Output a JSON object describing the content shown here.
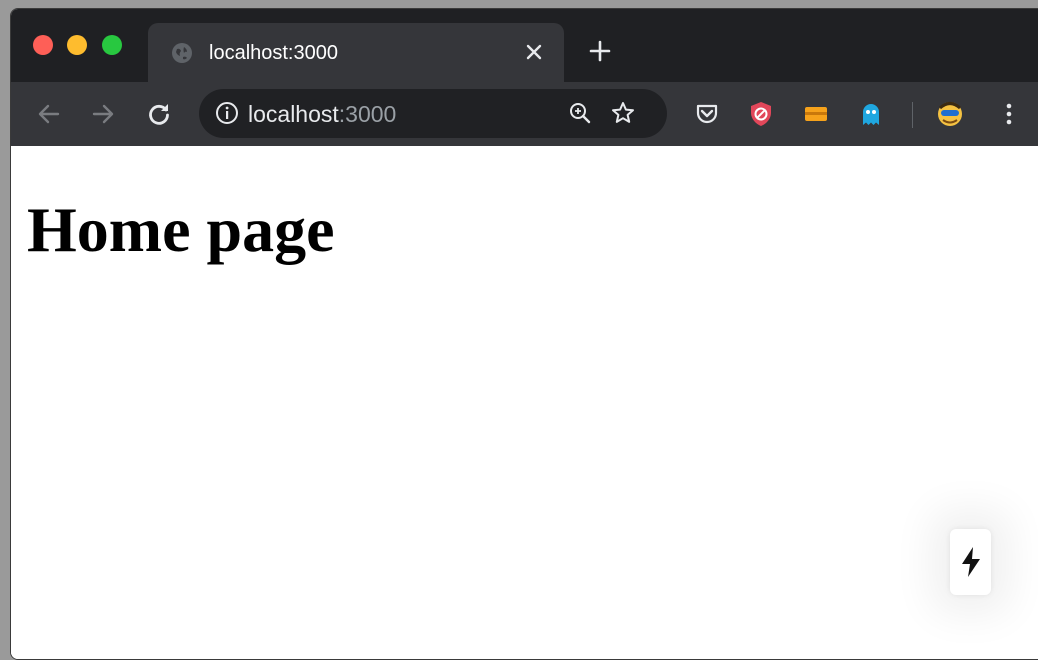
{
  "browser": {
    "tab": {
      "title": "localhost:3000",
      "favicon": "globe-icon"
    },
    "address_bar": {
      "host": "localhost",
      "port": ":3000"
    },
    "toolbar_icons": [
      "back-arrow-icon",
      "forward-arrow-icon",
      "reload-icon",
      "info-icon",
      "zoom-icon",
      "star-icon"
    ],
    "extensions": [
      "pocket-icon",
      "shield-extension-icon",
      "orange-extension-icon",
      "ghostery-icon",
      "avatar-extension-icon",
      "more-menu-icon"
    ],
    "colors": {
      "titlebar": "#1f2023",
      "toolbar": "#35363a",
      "omnibox": "#202124"
    }
  },
  "page": {
    "heading": "Home page",
    "floating_button_icon": "lightning-icon"
  }
}
